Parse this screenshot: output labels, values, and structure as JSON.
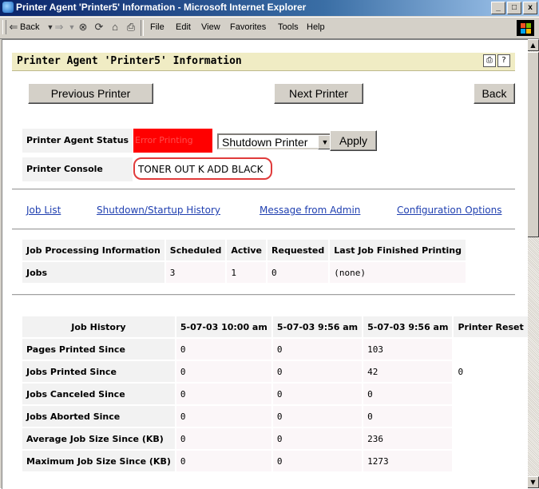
{
  "window": {
    "title": "Printer Agent 'Printer5' Information - Microsoft Internet Explorer",
    "controls": [
      "_",
      "□",
      "x"
    ]
  },
  "toolbar": {
    "back": "Back",
    "menu": [
      "File",
      "Edit",
      "View",
      "Favorites",
      "Tools",
      "Help"
    ]
  },
  "page": {
    "title": "Printer Agent 'Printer5' Information",
    "nav": {
      "previous": "Previous Printer",
      "next": "Next Printer",
      "back": "Back"
    },
    "status": {
      "label": "Printer Agent Status",
      "value": "Error Printing",
      "action": "Shutdown Printer",
      "apply": "Apply"
    },
    "console": {
      "label": "Printer Console",
      "value": "TONER OUT K ADD BLACK"
    },
    "links": [
      "Job List",
      "Shutdown/Startup History",
      "Message from Admin",
      "Configuration Options"
    ],
    "jobs": {
      "headers": [
        "Job Processing Information",
        "Scheduled",
        "Active",
        "Requested",
        "Last Job Finished Printing"
      ],
      "row": [
        "Jobs",
        "3",
        "1",
        "0",
        "(none)"
      ]
    },
    "history": {
      "headers": [
        "Job History",
        "5-07-03 10:00 am",
        "5-07-03 9:56 am",
        "5-07-03 9:56 am",
        "Printer Reset"
      ],
      "rows": [
        [
          "Pages Printed Since",
          "0",
          "0",
          "103",
          ""
        ],
        [
          "Jobs Printed Since",
          "0",
          "0",
          "42",
          "0"
        ],
        [
          "Jobs Canceled Since",
          "0",
          "0",
          "0",
          ""
        ],
        [
          "Jobs Aborted Since",
          "0",
          "0",
          "0",
          ""
        ],
        [
          "Average Job Size Since (KB)",
          "0",
          "0",
          "236",
          ""
        ],
        [
          "Maximum Job Size Since (KB)",
          "0",
          "0",
          "1273",
          ""
        ]
      ]
    }
  }
}
